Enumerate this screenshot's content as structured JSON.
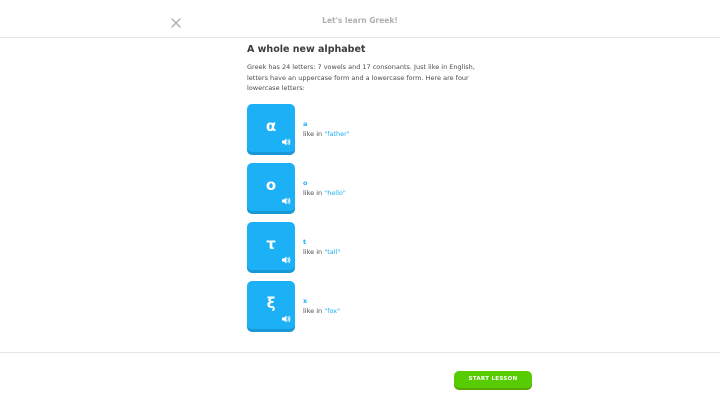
{
  "header": {
    "title": "Let's learn Greek!",
    "close_icon": "close-icon"
  },
  "content": {
    "title": "A whole new alphabet",
    "intro": "Greek has 24 letters: 7 vowels and 17 consonants. Just like in English, letters have an uppercase form and a lowercase form. Here are four lowercase letters:"
  },
  "letters": [
    {
      "letter": "α",
      "translit": "a",
      "prefix": "like in ",
      "word": "\"father\""
    },
    {
      "letter": "ο",
      "translit": "o",
      "prefix": "like in ",
      "word": "\"hello\""
    },
    {
      "letter": "τ",
      "translit": "t",
      "prefix": "like in ",
      "word": "\"tall\""
    },
    {
      "letter": "ξ",
      "translit": "x",
      "prefix": "like in ",
      "word": "\"fox\""
    }
  ],
  "footer": {
    "start_label": "START LESSON"
  },
  "colors": {
    "accent_blue": "#1cb0f6",
    "accent_green": "#58cc02"
  },
  "icons": {
    "speaker": "speaker-icon"
  }
}
